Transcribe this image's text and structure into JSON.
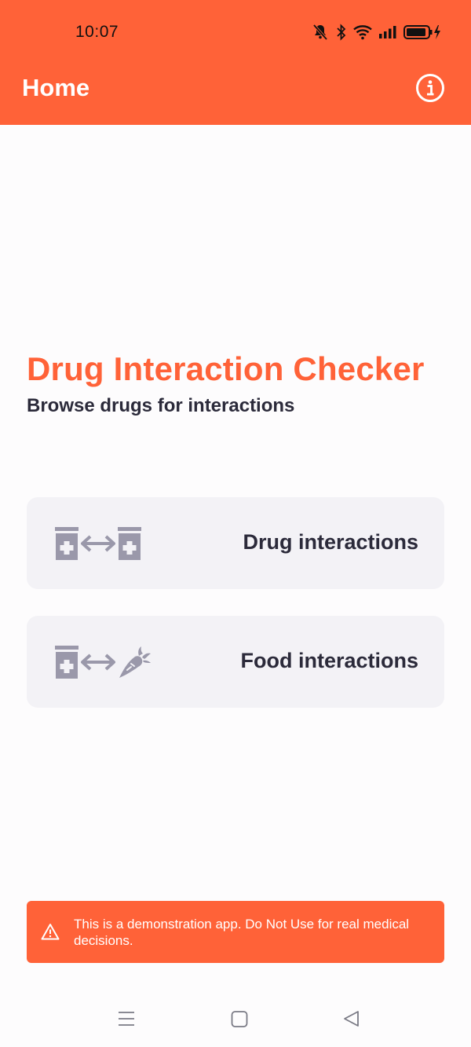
{
  "status_bar": {
    "time": "10:07",
    "icons": [
      "bell-muted-icon",
      "bluetooth-icon",
      "wifi-icon",
      "signal-icon",
      "battery-charging-icon"
    ]
  },
  "app_bar": {
    "title": "Home",
    "info_icon": "info-circle-icon"
  },
  "main": {
    "headline": "Drug Interaction Checker",
    "subheadline": "Browse drugs for interactions",
    "options": [
      {
        "label": "Drug interactions",
        "icons": [
          "pill-bottle-icon",
          "double-arrow-icon",
          "pill-bottle-icon"
        ]
      },
      {
        "label": "Food interactions",
        "icons": [
          "pill-bottle-icon",
          "double-arrow-icon",
          "carrot-icon"
        ]
      }
    ]
  },
  "warning_banner": {
    "icon": "warning-triangle-icon",
    "text": "This is a demonstration app. Do Not Use for real medical decisions."
  },
  "nav_bar": {
    "icons": [
      "menu-icon",
      "home-square-icon",
      "back-triangle-icon"
    ]
  },
  "colors": {
    "accent": "#ff6238",
    "card_bg": "#f3f2f6",
    "text_dark": "#2b2a3a",
    "icon_gray": "#9a98aa"
  }
}
